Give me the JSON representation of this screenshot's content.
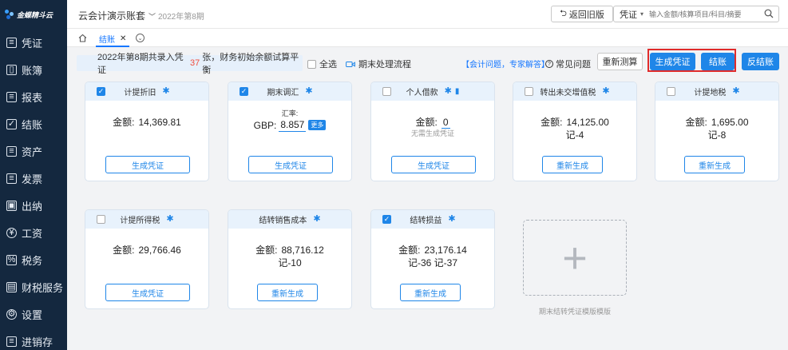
{
  "brand": {
    "name": "金蝶精斗云"
  },
  "sidebar": {
    "items": [
      {
        "label": "凭证",
        "icon": "voucher-icon"
      },
      {
        "label": "账簿",
        "icon": "ledger-icon"
      },
      {
        "label": "报表",
        "icon": "report-icon"
      },
      {
        "label": "结账",
        "icon": "closing-icon"
      },
      {
        "label": "资产",
        "icon": "asset-icon"
      },
      {
        "label": "发票",
        "icon": "invoice-icon"
      },
      {
        "label": "出纳",
        "icon": "cashier-icon"
      },
      {
        "label": "工资",
        "icon": "salary-icon"
      },
      {
        "label": "税务",
        "icon": "tax-icon"
      },
      {
        "label": "财税服务",
        "icon": "service-icon"
      },
      {
        "label": "设置",
        "icon": "settings-icon"
      },
      {
        "label": "进销存",
        "icon": "inventory-icon"
      }
    ]
  },
  "header": {
    "account": "云会计演示账套",
    "period": "2022年第8期",
    "back_label": "返回旧版",
    "search_type": "凭证",
    "search_placeholder": "输入金额/核算项目/科目/摘要"
  },
  "tabs": {
    "active": "结账"
  },
  "toolbar": {
    "info_prefix": "2022年第8期共录入凭证",
    "info_count": "37",
    "info_suffix": "张，财务初始余额试算平衡",
    "select_all": "全选",
    "flow_label": "期末处理流程",
    "expert_link": "【会计问题，专家解答】",
    "faq_label": "常见问题",
    "recalc_label": "重新测算",
    "generate_label": "生成凭证",
    "close_label": "结账",
    "unclose_label": "反结账"
  },
  "cards": [
    {
      "title": "计提折旧",
      "checked": true,
      "line1": "金额:",
      "value": "14,369.81",
      "button": "生成凭证"
    },
    {
      "title": "期末调汇",
      "checked": true,
      "rate_label": "汇率:",
      "rate_currency": "GBP:",
      "rate_value": "8.857",
      "more": "更多",
      "button": "生成凭证"
    },
    {
      "title": "个人借款",
      "checked": false,
      "line1": "金额:",
      "value": "0",
      "note": "无需生成凭证",
      "button": "生成凭证"
    },
    {
      "title": "转出未交增值税",
      "checked": false,
      "line1": "金额:",
      "value": "14,125.00",
      "line2": "记-4",
      "button": "重新生成"
    },
    {
      "title": "计提地税",
      "checked": false,
      "line1": "金额:",
      "value": "1,695.00",
      "line2": "记-8",
      "button": "重新生成"
    },
    {
      "title": "计提所得税",
      "checked": false,
      "line1": "金额:",
      "value": "29,766.46",
      "button": "生成凭证"
    },
    {
      "title": "结转销售成本",
      "checked": false,
      "line1": "金额:",
      "value": "88,716.12",
      "line2": "记-10",
      "button": "重新生成"
    },
    {
      "title": "结转损益",
      "checked": true,
      "line1": "金额:",
      "value": "23,176.14",
      "line2": "记-36 记-37",
      "button": "重新生成"
    }
  ],
  "add_template": {
    "caption": "期末结转凭证模版模版"
  }
}
